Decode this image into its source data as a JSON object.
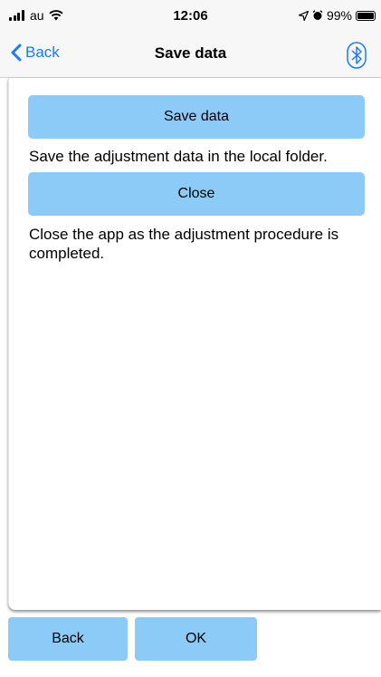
{
  "status_bar": {
    "carrier": "au",
    "time": "12:06",
    "battery": "99%"
  },
  "nav": {
    "back_label": "Back",
    "title": "Save data",
    "bluetooth_icon": "bluetooth-icon"
  },
  "main": {
    "save_button_label": "Save data",
    "save_description": "Save the adjustment data in the local folder.",
    "close_button_label": "Close",
    "close_description": "Close the app as the adjustment procedure is completed."
  },
  "footer": {
    "back_label": "Back",
    "ok_label": "OK"
  },
  "colors": {
    "accent": "#1a7af8",
    "button_bg": "#8ccaf7",
    "bar_bg": "#f7f7f7"
  }
}
